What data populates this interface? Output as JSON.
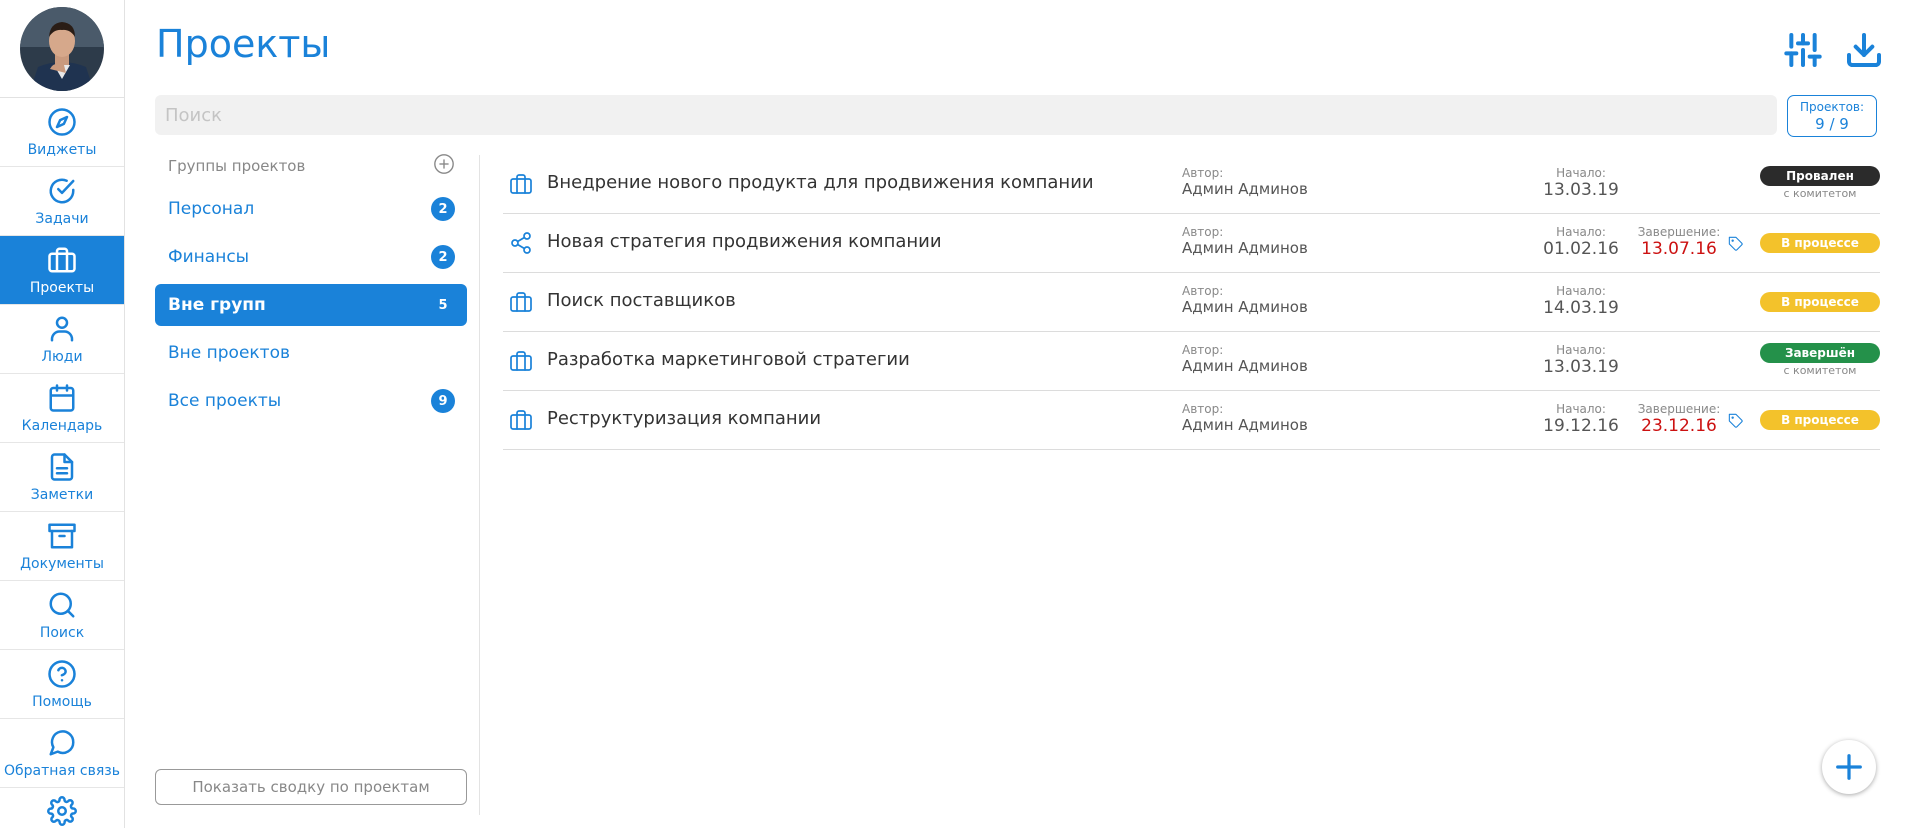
{
  "nav": {
    "items": [
      {
        "label": "Виджеты",
        "icon": "compass-icon"
      },
      {
        "label": "Задачи",
        "icon": "check-circle-icon"
      },
      {
        "label": "Проекты",
        "icon": "briefcase-icon"
      },
      {
        "label": "Люди",
        "icon": "person-icon"
      },
      {
        "label": "Календарь",
        "icon": "calendar-icon"
      },
      {
        "label": "Заметки",
        "icon": "document-icon"
      },
      {
        "label": "Документы",
        "icon": "archive-icon"
      },
      {
        "label": "Поиск",
        "icon": "search-icon"
      },
      {
        "label": "Помощь",
        "icon": "help-icon"
      },
      {
        "label": "Обратная связь",
        "icon": "chat-icon"
      }
    ],
    "active": "Проекты"
  },
  "header": {
    "title": "Проекты",
    "filter_icon": "sliders-icon",
    "download_icon": "download-icon"
  },
  "search": {
    "placeholder": "Поиск",
    "value": ""
  },
  "counter": {
    "label": "Проектов:",
    "value": "9 / 9"
  },
  "groups": {
    "header": "Группы проектов",
    "items": [
      {
        "label": "Персонал",
        "count": "2"
      },
      {
        "label": "Финансы",
        "count": "2"
      },
      {
        "label": "Вне групп",
        "count": "5"
      },
      {
        "label": "Вне проектов",
        "count": ""
      },
      {
        "label": "Все проекты",
        "count": "9"
      }
    ],
    "summary_button": "Показать сводку по проектам"
  },
  "projects": {
    "author_label": "Автор:",
    "start_label": "Начало:",
    "end_label": "Завершение:",
    "rows": [
      {
        "name": "Внедрение нового продукта для продвижения компании",
        "author": "Админ Админов",
        "start": "13.03.19",
        "end": "",
        "status": "Провален",
        "status_note": "с комитетом"
      },
      {
        "name": "Новая стратегия продвижения компании",
        "author": "Админ Админов",
        "start": "01.02.16",
        "end": "13.07.16",
        "status": "В процессе",
        "status_note": ""
      },
      {
        "name": "Поиск поставщиков",
        "author": "Админ Админов",
        "start": "14.03.19",
        "end": "",
        "status": "В процессе",
        "status_note": ""
      },
      {
        "name": "Разработка маркетинговой стратегии",
        "author": "Админ Админов",
        "start": "13.03.19",
        "end": "",
        "status": "Завершён",
        "status_note": "с комитетом"
      },
      {
        "name": "Реструктуризация компании",
        "author": "Админ Админов",
        "start": "19.12.16",
        "end": "23.12.16",
        "status": "В процессе",
        "status_note": ""
      }
    ]
  },
  "colors": {
    "accent": "#1a82d9",
    "failed": "#2b2b2b",
    "in_progress": "#f3c22b",
    "done": "#24914a",
    "overdue": "#cc1111"
  }
}
